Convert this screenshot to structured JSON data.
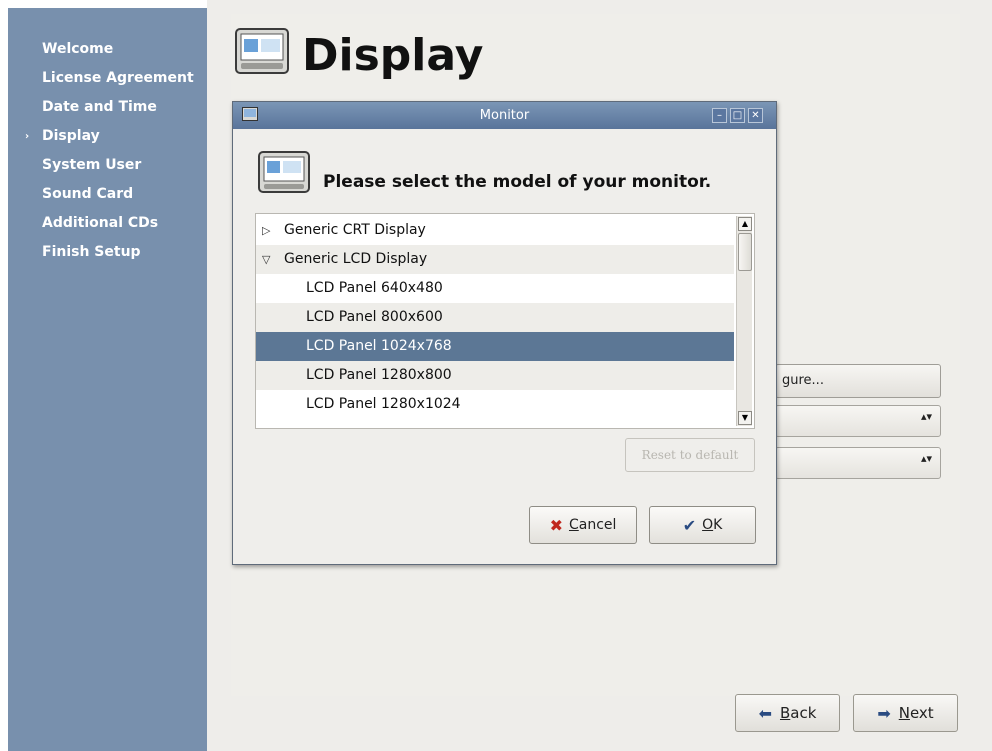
{
  "sidebar": {
    "current_marker": "›",
    "steps": [
      {
        "label": "Welcome",
        "current": false
      },
      {
        "label": "License Agreement",
        "current": false
      },
      {
        "label": "Date and Time",
        "current": false
      },
      {
        "label": "Display",
        "current": true
      },
      {
        "label": "System User",
        "current": false
      },
      {
        "label": "Sound Card",
        "current": false
      },
      {
        "label": "Additional CDs",
        "current": false
      },
      {
        "label": "Finish Setup",
        "current": false
      }
    ]
  },
  "page": {
    "title": "Display",
    "configure_button_partial": "gure...",
    "spin_glyph": "▴▾"
  },
  "nav": {
    "back_label": "Back",
    "back_mnemonic": "B",
    "back_rest": "ack",
    "next_label": "Next",
    "next_mnemonic": "N",
    "next_rest": "ext"
  },
  "dialog": {
    "title": "Monitor",
    "prompt": "Please select the model of your monitor.",
    "window_buttons": {
      "minimize": "–",
      "maximize": "□",
      "close": "✕"
    },
    "tree": [
      {
        "label": "Generic CRT Display",
        "level": 1,
        "expander": "▷",
        "selected": false
      },
      {
        "label": "Generic LCD Display",
        "level": 1,
        "expander": "▽",
        "selected": false
      },
      {
        "label": "LCD Panel 640x480",
        "level": 2,
        "expander": "",
        "selected": false
      },
      {
        "label": "LCD Panel 800x600",
        "level": 2,
        "expander": "",
        "selected": false
      },
      {
        "label": "LCD Panel 1024x768",
        "level": 2,
        "expander": "",
        "selected": true
      },
      {
        "label": "LCD Panel 1280x800",
        "level": 2,
        "expander": "",
        "selected": false
      },
      {
        "label": "LCD Panel 1280x1024",
        "level": 2,
        "expander": "",
        "selected": false
      }
    ],
    "scroll_up": "▲",
    "scroll_down": "▼",
    "reset_label": "Reset to default",
    "cancel": {
      "icon": "✖",
      "mnemonic": "C",
      "rest": "ancel",
      "label": "Cancel"
    },
    "ok": {
      "icon": "✔",
      "mnemonic": "O",
      "rest": "K",
      "label": "OK"
    }
  },
  "colors": {
    "sidebar_bg": "#7890ad",
    "selection": "#5c7795",
    "titlebar": "#6a85a8",
    "cancel_icon": "#c0281e"
  },
  "icons": {
    "page": "monitor-icon",
    "dialog": "monitor-icon",
    "back": "arrow-left-icon",
    "next": "arrow-right-icon"
  }
}
